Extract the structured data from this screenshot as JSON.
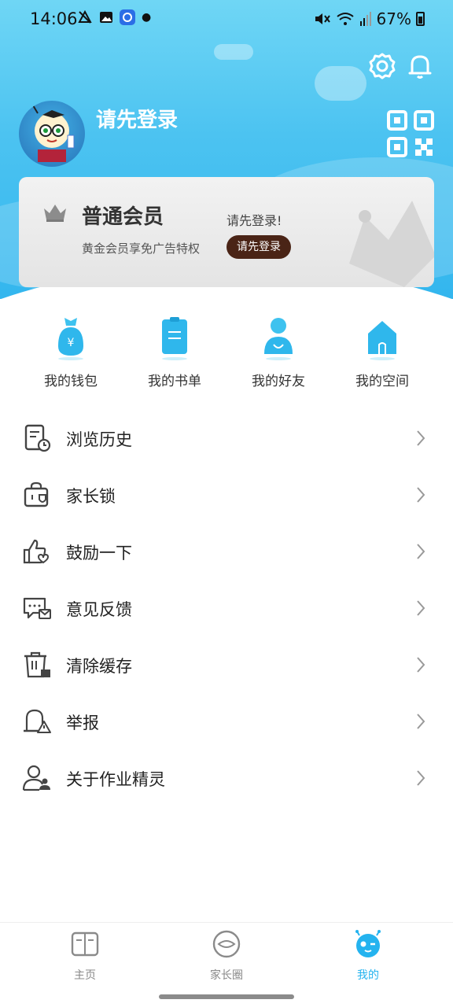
{
  "status_bar": {
    "time": "14:06",
    "battery": "67%",
    "left_icons": [
      "boat-icon",
      "image-icon",
      "app-icon",
      "dot"
    ],
    "right_icons": [
      "mute-icon",
      "wifi-icon",
      "signal-icon",
      "battery-icon"
    ]
  },
  "header": {
    "login_prompt": "请先登录",
    "icons": {
      "settings": "gear-icon",
      "notifications": "bell-icon",
      "qr": "qr-code-icon"
    }
  },
  "member_card": {
    "level": "普通会员",
    "subtitle": "黄金会员享免广告特权",
    "hint": "请先登录!",
    "button_label": "请先登录"
  },
  "quick_entries": [
    {
      "label": "我的钱包",
      "icon": "wallet-icon"
    },
    {
      "label": "我的书单",
      "icon": "booklist-icon"
    },
    {
      "label": "我的好友",
      "icon": "friend-icon"
    },
    {
      "label": "我的空间",
      "icon": "home-icon"
    }
  ],
  "menu": [
    {
      "label": "浏览历史",
      "icon": "history-icon"
    },
    {
      "label": "家长锁",
      "icon": "parent-lock-icon"
    },
    {
      "label": "鼓励一下",
      "icon": "thumbs-up-icon"
    },
    {
      "label": "意见反馈",
      "icon": "feedback-icon"
    },
    {
      "label": "清除缓存",
      "icon": "trash-icon"
    },
    {
      "label": "举报",
      "icon": "report-icon"
    },
    {
      "label": "关于作业精灵",
      "icon": "about-icon"
    }
  ],
  "bottom_nav": [
    {
      "label": "主页",
      "icon": "book-icon",
      "active": false
    },
    {
      "label": "家长圈",
      "icon": "eye-icon",
      "active": false
    },
    {
      "label": "我的",
      "icon": "mascot-icon",
      "active": true
    }
  ],
  "colors": {
    "accent": "#24b3ef",
    "header_top": "#6fd6f5",
    "header_bottom": "#33b6ee",
    "member_button": "#4a2416"
  }
}
